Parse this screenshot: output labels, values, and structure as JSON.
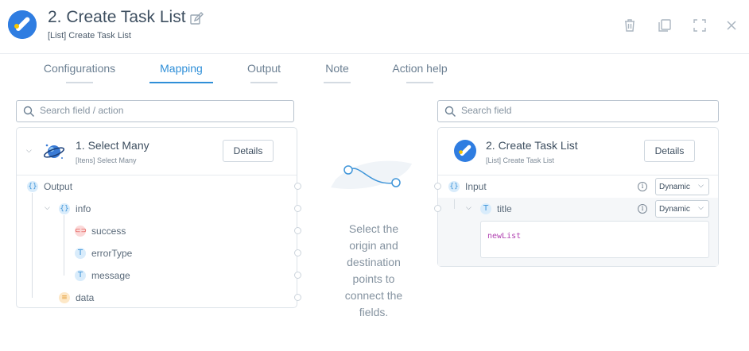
{
  "header": {
    "title": "2. Create Task List",
    "subtitle": "[List] Create Task List",
    "icon": "google-tasks-icon",
    "actions": [
      "trash-icon",
      "copy-icon",
      "fullscreen-icon",
      "close-icon"
    ]
  },
  "tabs": [
    {
      "label": "Configurations"
    },
    {
      "label": "Mapping",
      "active": true
    },
    {
      "label": "Output"
    },
    {
      "label": "Note"
    },
    {
      "label": "Action help"
    }
  ],
  "left": {
    "search_placeholder": "Search field / action",
    "panel": {
      "title": "1. Select Many",
      "subtitle": "[Itens] Select Many",
      "details_label": "Details",
      "icon": "cosmos-planet-icon",
      "fields": [
        {
          "label": "Output",
          "type": "object"
        },
        {
          "label": "info",
          "type": "object"
        },
        {
          "label": "success",
          "type": "boolean"
        },
        {
          "label": "errorType",
          "type": "text"
        },
        {
          "label": "message",
          "type": "text"
        },
        {
          "label": "data",
          "type": "array"
        }
      ]
    }
  },
  "center": {
    "hint": "Select the origin and destination points to connect the fields."
  },
  "right": {
    "search_placeholder": "Search field",
    "panel": {
      "title": "2. Create Task List",
      "subtitle": "[List] Create Task List",
      "details_label": "Details",
      "fields": [
        {
          "label": "Input",
          "type": "object",
          "mode": "Dynamic"
        },
        {
          "label": "title",
          "type": "text",
          "mode": "Dynamic",
          "value": "newList"
        }
      ]
    }
  },
  "colors": {
    "accent": "#2f8fd8",
    "value_text": "#b03fb0"
  }
}
